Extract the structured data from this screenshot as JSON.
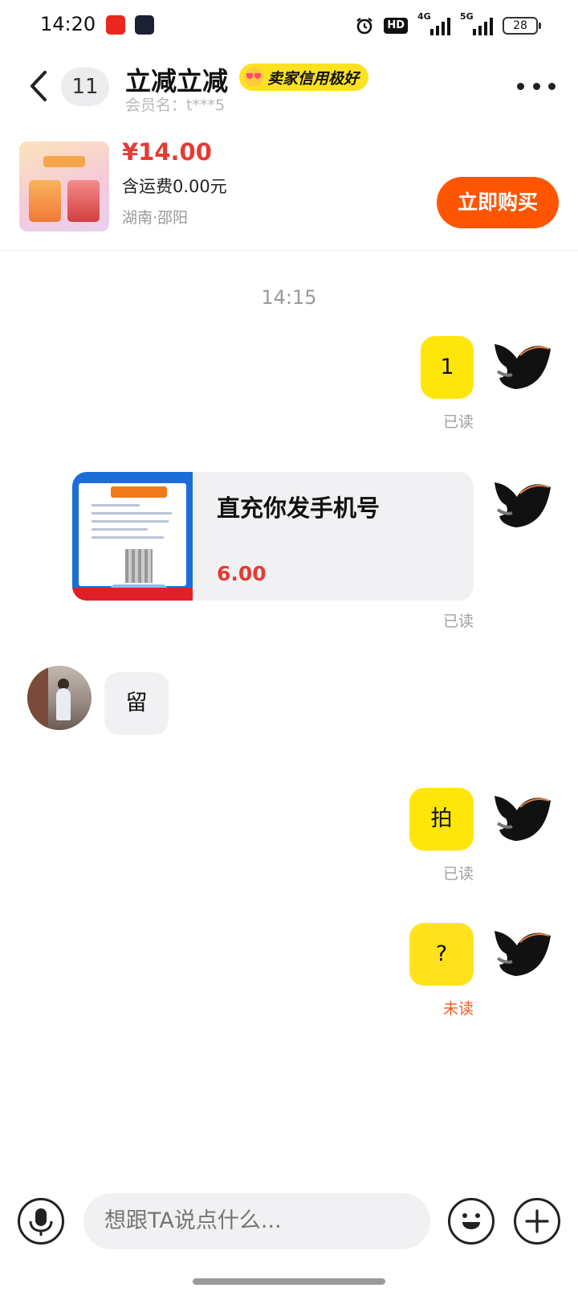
{
  "status_bar": {
    "time": "14:20",
    "network_hd": "HD",
    "signal_1_label": "4G",
    "signal_2_label": "5G",
    "battery": "28"
  },
  "header": {
    "back_icon": "chevron-left-icon",
    "unread_count": "11",
    "seller_name": "立减立减",
    "credit_badge": "卖家信用极好",
    "member_id": "会员名：t***5",
    "more_icon": "more-horizontal-icon"
  },
  "product": {
    "price": "¥14.00",
    "shipping": "含运费0.00元",
    "location": "湖南·邵阳",
    "buy_label": "立即购买"
  },
  "chat": {
    "time_divider": "14:15",
    "messages": [
      {
        "from": "me",
        "text": "1",
        "status": "已读"
      },
      {
        "from": "me",
        "type": "card",
        "title": "直充你发手机号",
        "price": "6.00",
        "status": "已读"
      },
      {
        "from": "them",
        "text": "留"
      },
      {
        "from": "me",
        "text": "拍",
        "status": "已读"
      },
      {
        "from": "me",
        "text": "?",
        "status": "未读"
      }
    ]
  },
  "input": {
    "placeholder": "想跟TA说点什么...",
    "voice_icon": "microphone-icon",
    "emoji_icon": "smiley-icon",
    "plus_icon": "plus-icon"
  },
  "colors": {
    "accent_yellow": "#ffe60a",
    "price_red": "#e63a32",
    "buy_orange": "#ff5500",
    "unread_orange": "#f05a23"
  }
}
